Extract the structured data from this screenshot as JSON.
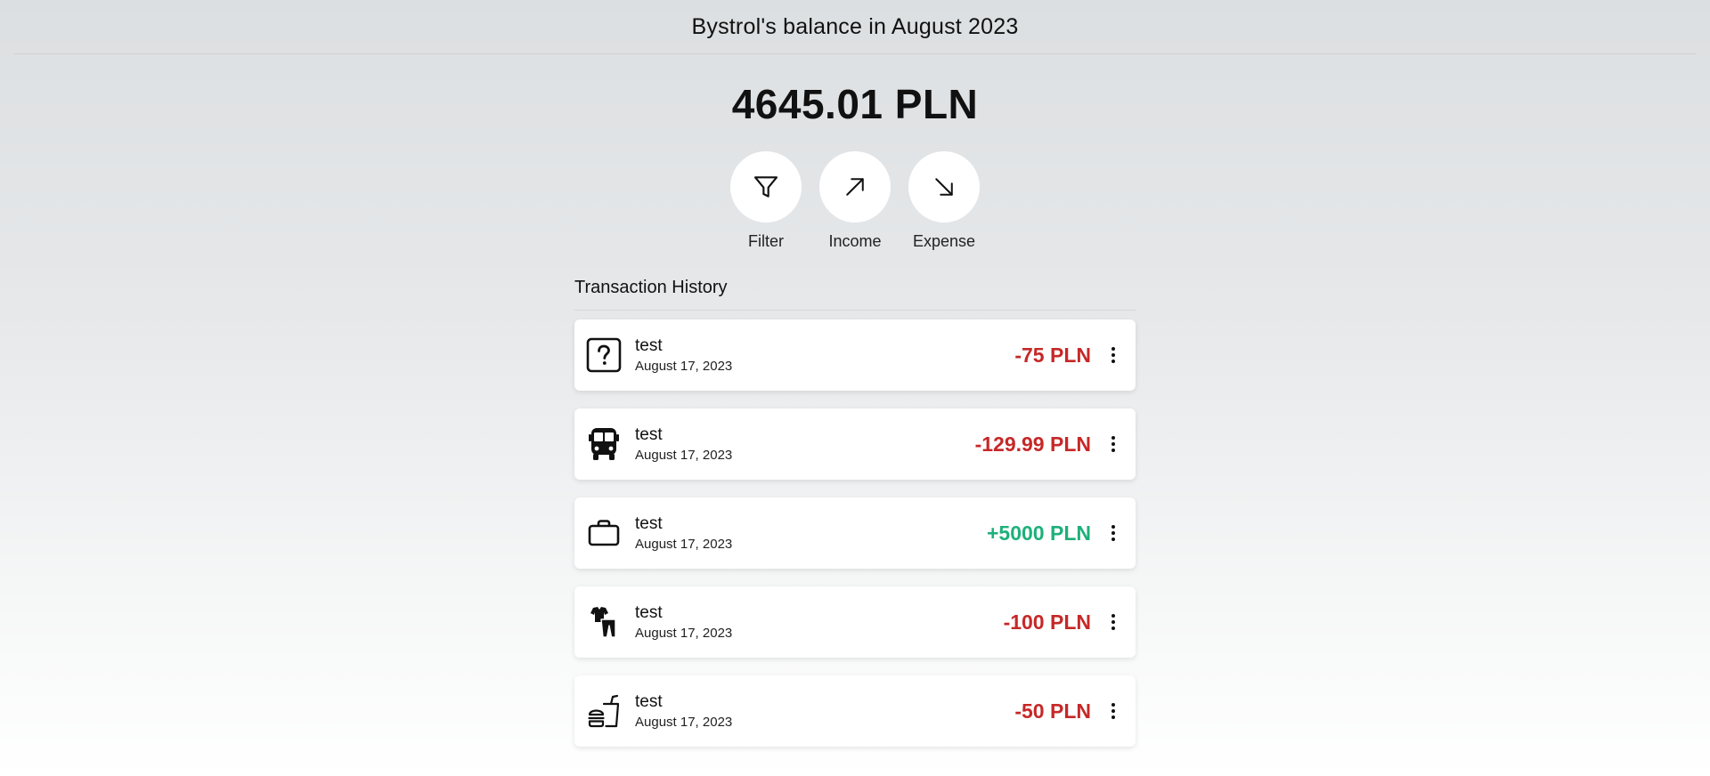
{
  "header": {
    "title": "Bystrol's balance in August 2023"
  },
  "balance": {
    "amount": "4645.01 PLN"
  },
  "actions": [
    {
      "label": "Filter",
      "icon": "filter-icon"
    },
    {
      "label": "Income",
      "icon": "arrow-up-right-icon"
    },
    {
      "label": "Expense",
      "icon": "arrow-down-right-icon"
    }
  ],
  "history": {
    "title": "Transaction History",
    "transactions": [
      {
        "name": "test",
        "date": "August 17, 2023",
        "amount": "-75 PLN",
        "type": "expense",
        "icon": "question-mark-icon"
      },
      {
        "name": "test",
        "date": "August 17, 2023",
        "amount": "-129.99 PLN",
        "type": "expense",
        "icon": "bus-icon"
      },
      {
        "name": "test",
        "date": "August 17, 2023",
        "amount": "+5000 PLN",
        "type": "income",
        "icon": "briefcase-icon"
      },
      {
        "name": "test",
        "date": "August 17, 2023",
        "amount": "-100 PLN",
        "type": "expense",
        "icon": "clothes-icon"
      },
      {
        "name": "test",
        "date": "August 17, 2023",
        "amount": "-50 PLN",
        "type": "expense",
        "icon": "fast-food-icon"
      }
    ]
  },
  "colors": {
    "expense": "#c62828",
    "income": "#1eb07a",
    "card_background": "#ffffff"
  }
}
